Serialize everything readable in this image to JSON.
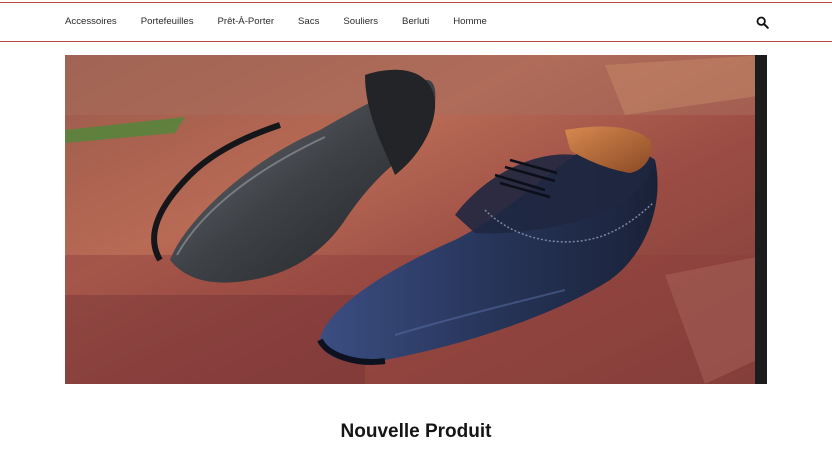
{
  "nav": {
    "items": [
      {
        "label": "Accessoires"
      },
      {
        "label": "Portefeuilles"
      },
      {
        "label": "Prêt-À-Porter"
      },
      {
        "label": "Sacs"
      },
      {
        "label": "Souliers"
      },
      {
        "label": "Berluti"
      },
      {
        "label": "Homme"
      }
    ],
    "search_icon": "search-icon",
    "accent_color": "#b9474a"
  },
  "hero": {
    "slides_total": 2,
    "active_slide": 1
  },
  "section": {
    "title": "Nouvelle Produit"
  }
}
